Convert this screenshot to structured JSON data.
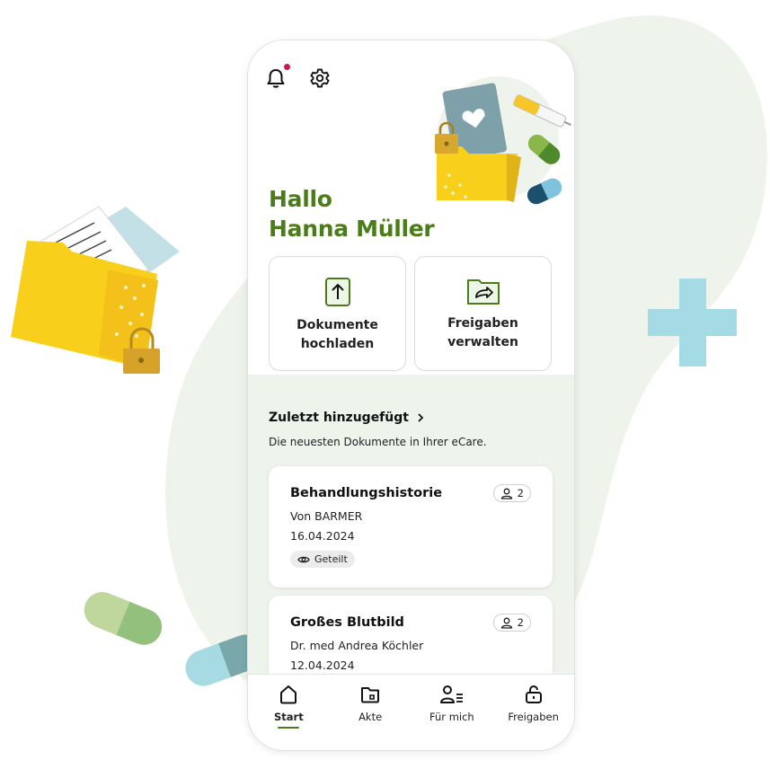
{
  "header": {
    "bell_icon": "bell-icon",
    "settings_icon": "gear-icon",
    "has_notification": true
  },
  "greeting": {
    "line1": "Hallo",
    "line2": "Hanna Müller"
  },
  "actions": [
    {
      "icon": "upload-icon",
      "label": "Dokumente\nhochladen"
    },
    {
      "icon": "share-folder-icon",
      "label": "Freigaben\nverwalten"
    }
  ],
  "recent": {
    "title": "Zuletzt hinzugefügt",
    "subtitle": "Die neuesten Dokumente in Ihrer eCare."
  },
  "documents": [
    {
      "title": "Behandlungshistorie",
      "from": "Von BARMER",
      "date": "16.04.2024",
      "count": "2",
      "status": "Geteilt"
    },
    {
      "title": "Großes Blutbild",
      "from": "Dr. med Andrea Köchler",
      "date": "12.04.2024",
      "count": "2"
    }
  ],
  "nav": [
    {
      "label": "Start",
      "icon": "home-icon",
      "active": true
    },
    {
      "label": "Akte",
      "icon": "folder-icon",
      "active": false
    },
    {
      "label": "Für mich",
      "icon": "user-list-icon",
      "active": false
    },
    {
      "label": "Freigaben",
      "icon": "unlock-icon",
      "active": false
    }
  ],
  "colors": {
    "brand_green": "#4a7d1a",
    "notification": "#c9155a",
    "background_blob": "#eef3ec",
    "plus_cross": "#a4dbe4",
    "folder_yellow": "#f4c51b"
  }
}
